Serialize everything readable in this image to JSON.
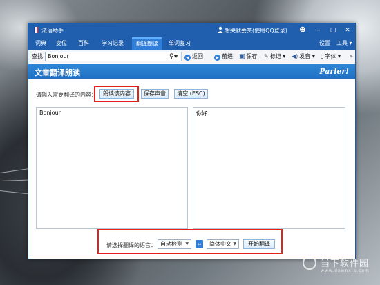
{
  "window": {
    "title": "法语助手",
    "user": "想哭就要笑(使用QQ登录)",
    "controls": {
      "skin": "☻",
      "minimize": "–",
      "maximize": "□",
      "close": "✕"
    }
  },
  "tabs": [
    {
      "label": "词典",
      "active": false
    },
    {
      "label": "变位",
      "active": false
    },
    {
      "label": "百科",
      "active": false
    },
    {
      "label": "学习记录",
      "active": false
    },
    {
      "label": "翻译朗读",
      "active": true
    },
    {
      "label": "单词复习",
      "active": false
    }
  ],
  "tab_right": {
    "settings": "设置",
    "tools": "工具"
  },
  "toolbar": {
    "search_label": "查找",
    "search_value": "Bonjour",
    "back": "返回",
    "forward": "前进",
    "save": "保存",
    "mark": "标记",
    "pronounce": "发音",
    "font": "字体",
    "more": "»"
  },
  "banner": {
    "title": "文章翻译朗读",
    "brand": "Parler!"
  },
  "prompt": "请输入需要翻译的内容：",
  "actions": {
    "read": "朗读该内容",
    "save_audio": "保存声音",
    "clear": "清空 (ESC)"
  },
  "source_text": "Bonjour",
  "target_text": "你好",
  "language": {
    "label": "请选择翻译的语言：",
    "from": "自动检测",
    "to": "简体中文",
    "swap": "⇔",
    "translate": "开始翻译"
  },
  "watermark": {
    "main": "当下软件园",
    "sub": "www.downxia.com"
  },
  "colors": {
    "titlebar": "#1f5fae",
    "accent": "#2f7ed8",
    "highlight": "#e3211c"
  }
}
